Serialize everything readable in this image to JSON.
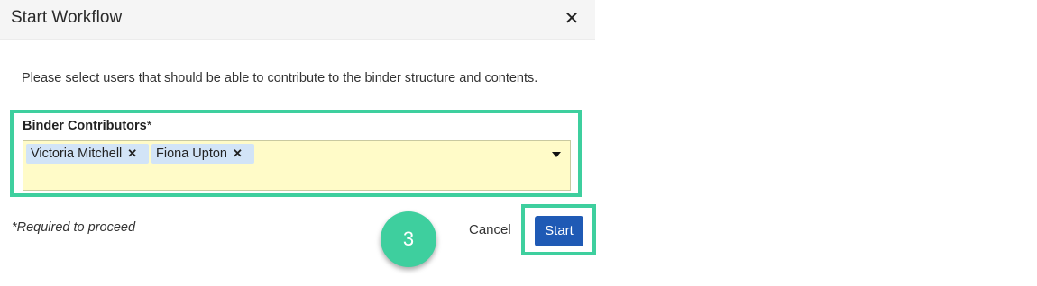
{
  "dialog": {
    "title": "Start Workflow",
    "close_icon": "close-icon",
    "close_glyph": "✕",
    "instructions": "Please select users that should be able to contribute to the binder structure and contents.",
    "field": {
      "label": "Binder Contributors",
      "required_marker": "*",
      "selected": [
        {
          "name": "Victoria Mitchell",
          "remove_glyph": "✕"
        },
        {
          "name": "Fiona Upton",
          "remove_glyph": "✕"
        }
      ],
      "dropdown_icon": "caret-down-icon"
    },
    "required_note": "*Required to proceed",
    "buttons": {
      "cancel": "Cancel",
      "start": "Start"
    }
  },
  "annotation": {
    "step_number": "3"
  },
  "colors": {
    "highlight": "#3ecf9e",
    "primary_button": "#1f5ab5",
    "input_background": "#fffbc8",
    "chip_background": "#d2e4f7"
  }
}
